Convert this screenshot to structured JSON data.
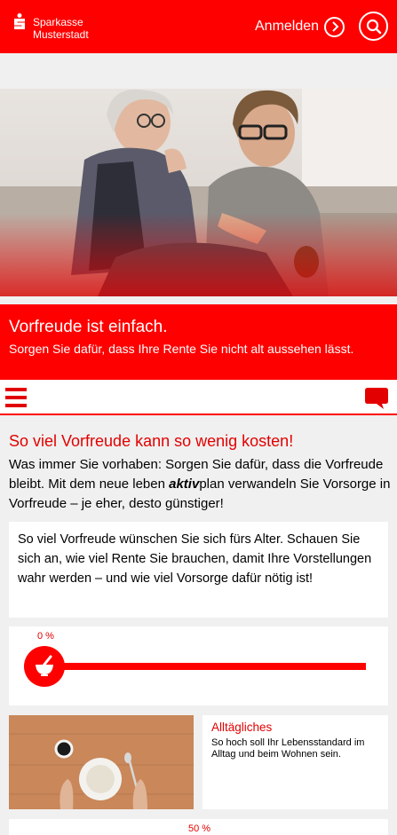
{
  "header": {
    "logo_line1": "Sparkasse",
    "logo_line2": "Musterstadt",
    "login_label": "Anmelden",
    "login_icon": "chevron-right-icon",
    "search_icon": "search-icon",
    "brand_color": "#ff0000"
  },
  "banner": {
    "title": "Vorfreude ist einfach.",
    "subtitle": "Sorgen Sie dafür, dass Ihre Rente Sie nicht alt aussehen lässt."
  },
  "nav": {
    "menu_icon": "hamburger-menu-icon",
    "chat_icon": "chat-bubble-icon"
  },
  "main": {
    "headline": "So viel Vorfreude kann so wenig kosten!",
    "intro_part1": "Was immer Sie vorhaben: Sorgen Sie dafür, dass die Vorfreude bleibt. Mit dem neue leben ",
    "intro_brand": "aktiv",
    "intro_part2": "plan verwandeln Sie Vorsorge in Vorfreude – je eher, desto günstiger!",
    "card_text": "So viel Vorfreude wünschen Sie sich fürs Alter. Schauen Sie sich an, wie viel Rente Sie brauchen, damit Ihre Vorstellungen wahr werden – und wie viel Vorsorge dafür nötig ist!"
  },
  "sliders": [
    {
      "percent_label": "0 %",
      "icon": "mortar-pestle-icon"
    },
    {
      "percent_label": "50 %"
    }
  ],
  "category": {
    "title": "Alltägliches",
    "description": "So hoch soll Ihr Lebensstandard im Alltag und beim Wohnen sein."
  }
}
